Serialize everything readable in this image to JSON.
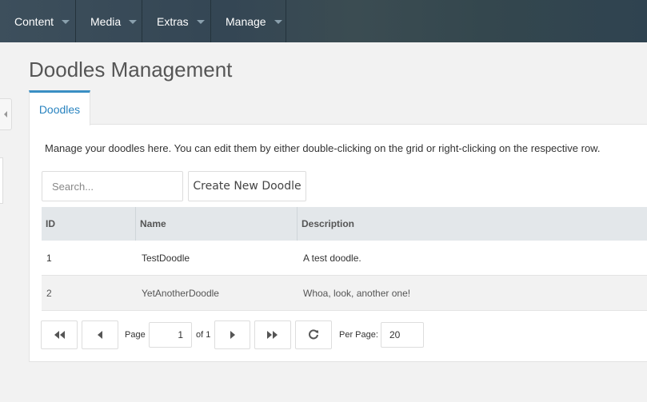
{
  "nav": {
    "items": [
      {
        "label": "Content"
      },
      {
        "label": "Media"
      },
      {
        "label": "Extras"
      },
      {
        "label": "Manage"
      }
    ]
  },
  "page": {
    "title": "Doodles Management",
    "tab_label": "Doodles",
    "intro": "Manage your doodles here. You can edit them by either double-clicking on the grid or right-clicking on the respective row."
  },
  "toolbar": {
    "search_placeholder": "Search...",
    "create_label": "Create New Doodle"
  },
  "grid": {
    "columns": [
      "ID",
      "Name",
      "Description"
    ],
    "rows": [
      {
        "id": "1",
        "name": "TestDoodle",
        "description": "A test doodle."
      },
      {
        "id": "2",
        "name": "YetAnotherDoodle",
        "description": "Whoa, look, another one!"
      }
    ]
  },
  "pager": {
    "page_label": "Page",
    "current_page": "1",
    "of_label": "of 1",
    "per_page_label": "Per Page:",
    "per_page_value": "20"
  },
  "colors": {
    "accent": "#3a8fc4",
    "nav_bg": "#344654",
    "grid_header": "#e3e7ea"
  },
  "icons": {
    "first": "double-chevron-left-icon",
    "prev": "chevron-left-icon",
    "next": "chevron-right-icon",
    "last": "double-chevron-right-icon",
    "refresh": "refresh-icon"
  }
}
